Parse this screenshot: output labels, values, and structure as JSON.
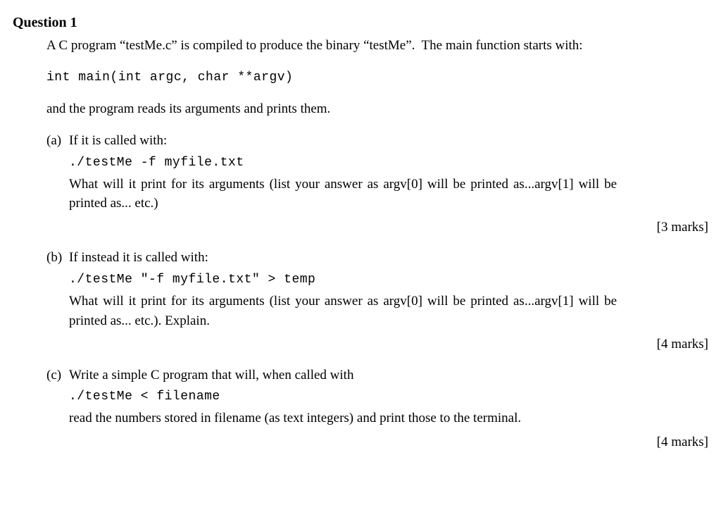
{
  "header": "Question 1",
  "intro": "A C program “testMe.c” is compiled to produce the binary “testMe”.  The main function starts with:",
  "code": "int main(int argc, char **argv)",
  "after_code": "and the program reads its arguments and prints them.",
  "parts": [
    {
      "label": "(a)",
      "lead": "If it is called with:",
      "code": "./testMe -f myfile.txt",
      "follow": "What will it print for its arguments (list your answer as argv[0] will be printed as...argv[1] will be printed as... etc.)",
      "marks": "[3 marks]"
    },
    {
      "label": "(b)",
      "lead": "If instead it is called with:",
      "code": "./testMe \"-f myfile.txt\" > temp",
      "follow": "What will it print for its arguments (list your answer as argv[0] will be printed as...argv[1] will be printed as... etc.). Explain.",
      "marks": "[4 marks]"
    },
    {
      "label": "(c)",
      "lead": "Write a simple C program that will, when called with",
      "code": "./testMe < filename",
      "follow": "read the numbers stored in filename (as text integers) and print those to the terminal.",
      "marks": "[4 marks]"
    }
  ]
}
